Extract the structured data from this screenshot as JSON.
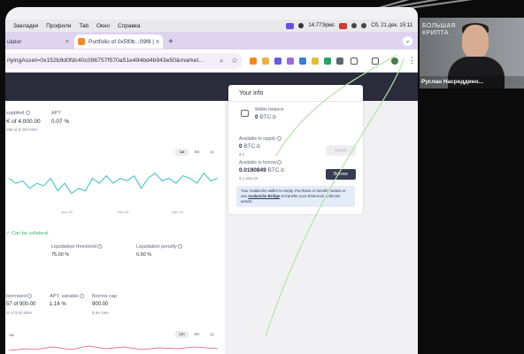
{
  "menubar": {
    "items": [
      "Закладки",
      "Профили",
      "Tab",
      "Окно",
      "Справка"
    ],
    "speed": "14.77Эрмс",
    "clock": "Сб, 21 дек. 15:11",
    "badge_colors": [
      "#6b4fd8",
      "#d23a3a"
    ]
  },
  "tabs": [
    {
      "label": "ulator",
      "close": "×"
    },
    {
      "label": "Portfolio of 0x5f0b...09f8 | ...",
      "close": "×"
    }
  ],
  "newtab": "+",
  "tab_dropdown": "⌄",
  "address": {
    "url": "rlyingAsset=0x152b9d0fdc40c096757f570a51e494bd4b943e50&market..."
  },
  "toolbar": {
    "zoom_icon": "⌕",
    "star_icon": "☆",
    "menu_icon": "⋮"
  },
  "stats": {
    "supplied_label": "supplied",
    "supplied_value": "K of 4,000.00",
    "supplied_sub": "MM of $ 380.00M",
    "apy_label": "APY",
    "apy_value": "0.07 %",
    "range_buttons": [
      "1м",
      "6м",
      "1y"
    ],
    "collateral": "✓ Can be collateral",
    "liq_threshold_label": "Liquidation threshold",
    "liq_threshold_value": "75.00 %",
    "liq_penalty_label": "Liquidation penalty",
    "liq_penalty_value": "6.50 %",
    "borrowed_label": "borrowed",
    "borrowed_value": "57 of 900.00",
    "borrowed_sub": "M of $ 80.89M",
    "apy_var_label": "APY, variable",
    "apy_var_value": "1.16 %",
    "borrow_cap_label": "Borrow cap",
    "borrow_cap_value": "900.00",
    "borrow_cap_sub": "$ 89.19M",
    "bottom_range_left": "1м",
    "bottom_range_buttons": [
      "1m",
      "6m",
      "1y"
    ]
  },
  "info": {
    "title": "Your info",
    "wallet_label": "Wallet balance",
    "wallet_value": "0",
    "wallet_unit": "BTC.b",
    "supply_label": "Available to supply",
    "supply_value": "0",
    "supply_unit": "BTC.b",
    "supply_sub": "$ 0",
    "supply_btn": "Supply",
    "borrow_label": "Available to borrow",
    "borrow_value": "0.0190849",
    "borrow_unit": "BTC.b",
    "borrow_sub": "$ 1,855.00",
    "borrow_btn": "Borrow",
    "notice_pre": "Your Avalanche wallet is empty. Purchase or transfer assets or use ",
    "notice_link": "Avalanche Bridge",
    "notice_post": " to transfer your Ethereum & Bitcoin assets."
  },
  "webcam": {
    "brand_line1": "БОЛЬШАЯ",
    "brand_line2": "КРИПТА",
    "name": "Руслан Насреддино..."
  },
  "chart_data": {
    "type": "line",
    "x": [
      0,
      1,
      2,
      3,
      4,
      5,
      6,
      7,
      8,
      9,
      10,
      11,
      12,
      13,
      14,
      15,
      16,
      17,
      18,
      19,
      20,
      21,
      22,
      23,
      24,
      25,
      26,
      27,
      28,
      29,
      30
    ],
    "series": [
      {
        "values": [
          0.07,
          0.06,
          0.065,
          0.05,
          0.06,
          0.055,
          0.07,
          0.045,
          0.06,
          0.04,
          0.05,
          0.045,
          0.07,
          0.06,
          0.075,
          0.06,
          0.07,
          0.065,
          0.075,
          0.05,
          0.07,
          0.08,
          0.065,
          0.07,
          0.06,
          0.075,
          0.07,
          0.06,
          0.08,
          0.065,
          0.07
        ]
      }
    ],
    "xlabels": [
      "Nov 26",
      "Dec 09",
      "Dec 19"
    ],
    "grid": false,
    "color": "#29b6c9"
  }
}
